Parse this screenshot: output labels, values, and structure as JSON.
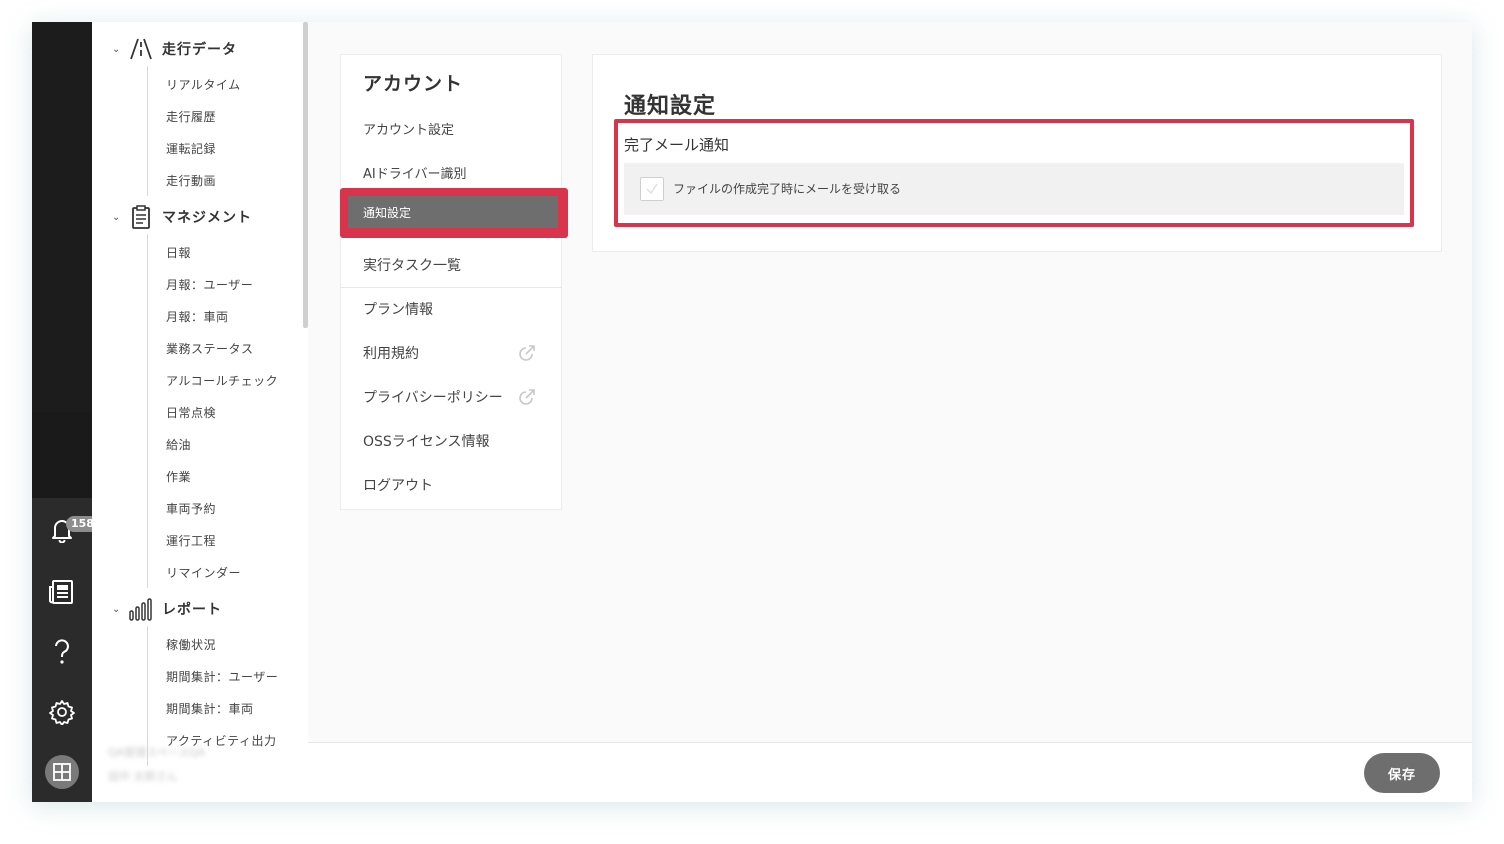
{
  "nav": {
    "sections": [
      {
        "title": "走行データ",
        "items": [
          "リアルタイム",
          "走行履歴",
          "運転記録",
          "走行動画"
        ]
      },
      {
        "title": "マネジメント",
        "items": [
          "日報",
          "月報：ユーザー",
          "月報：車両",
          "業務ステータス",
          "アルコールチェック",
          "日常点検",
          "給油",
          "作業",
          "車両予約",
          "運行工程",
          "リマインダー"
        ]
      },
      {
        "title": "レポート",
        "items": [
          "稼働状況",
          "期間集計：ユーザー",
          "期間集計：車両",
          "アクティビティ出力"
        ]
      }
    ],
    "user": {
      "workspace": "QA管理スペースQA",
      "name": "田中 太郎さん"
    }
  },
  "rail": {
    "notification_count": "158"
  },
  "account_menu": {
    "title": "アカウント",
    "items": [
      "アカウント設定",
      "AIドライバー識別",
      "通知設定",
      "実行タスク一覧",
      "プラン情報",
      "利用規約",
      "プライバシーポリシー",
      "OSSライセンス情報",
      "ログアウト"
    ],
    "selected": "通知設定"
  },
  "panel": {
    "title": "通知設定",
    "section_title": "完了メール通知",
    "option_label": "ファイルの作成完了時にメールを受け取る",
    "option_checked": true
  },
  "footer": {
    "save_label": "保存"
  },
  "colors": {
    "highlight": "#d9344b",
    "selected_bg": "#6e6e6e",
    "rail": "#1f1f1f"
  }
}
